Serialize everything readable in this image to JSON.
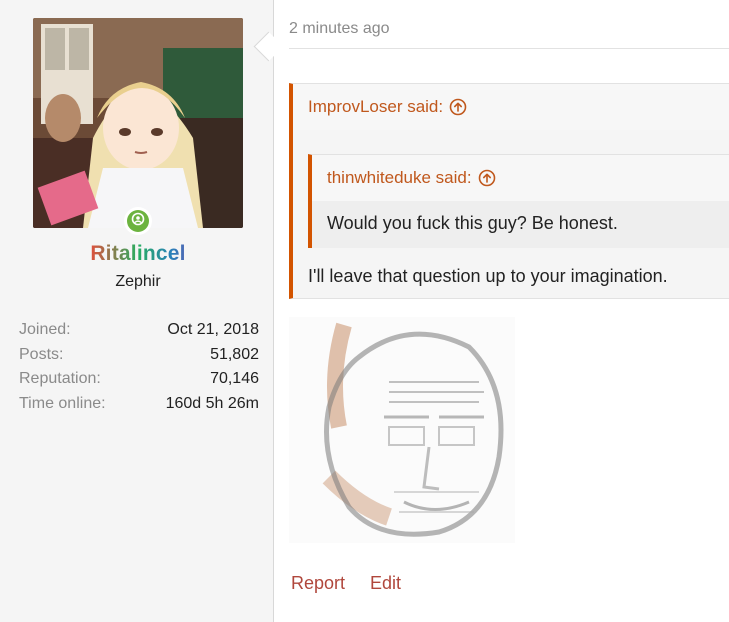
{
  "user": {
    "name": "Ritalincel",
    "title": "Zephir",
    "stats": [
      {
        "label": "Joined:",
        "value": "Oct 21, 2018"
      },
      {
        "label": "Posts:",
        "value": "51,802"
      },
      {
        "label": "Reputation:",
        "value": "70,146"
      },
      {
        "label": "Time online:",
        "value": "160d 5h 26m"
      }
    ]
  },
  "post": {
    "date": "2 minutes ago",
    "quote": {
      "author": "ImprovLoser said:",
      "text": "I'll leave that question up to your imagination.",
      "nested": {
        "author": "thinwhiteduke said:",
        "text": "Would you fuck this guy? Be honest."
      }
    },
    "actions": {
      "report": "Report",
      "edit": "Edit"
    }
  },
  "colors": {
    "accent": "#d35400",
    "link": "#c0581d",
    "action": "#b0473c",
    "online": "#6cb33f"
  },
  "icons": {
    "quote_arrow": "arrow-up-circle-icon",
    "online": "user-icon"
  }
}
